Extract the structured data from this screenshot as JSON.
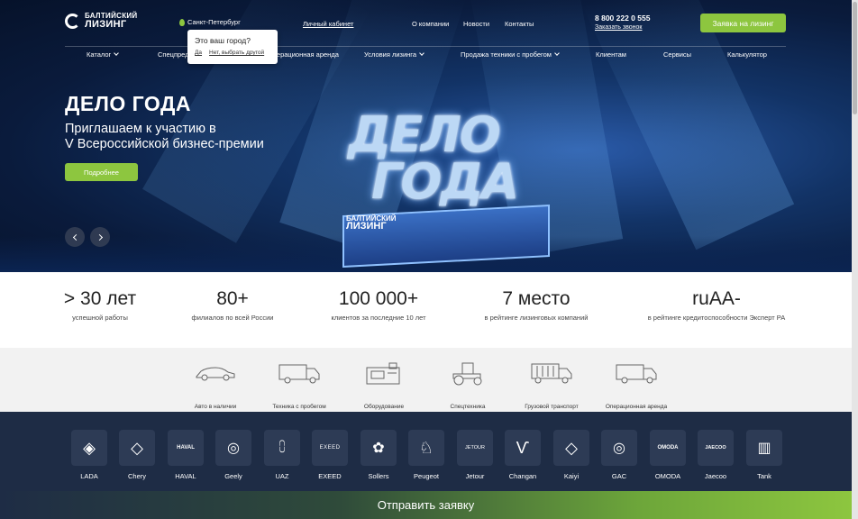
{
  "header": {
    "logo_line1": "БАЛТИЙСКИЙ",
    "logo_line2": "ЛИЗИНГ",
    "city": "Санкт-Петербург",
    "cabinet": "Личный кабинет",
    "top_links": [
      "О компании",
      "Новости",
      "Контакты"
    ],
    "phone": "8 800 222 0 555",
    "callback": "Заказать звонок",
    "apply": "Заявка на лизинг"
  },
  "city_popup": {
    "question": "Это ваш город?",
    "yes": "Да",
    "no": "Нет, выбрать другой"
  },
  "nav": [
    {
      "label": "Каталог",
      "dropdown": true
    },
    {
      "label": "Спецпред",
      "dropdown": false
    },
    {
      "label": "Операционная аренда",
      "dropdown": false
    },
    {
      "label": "Условия лизинга",
      "dropdown": true
    },
    {
      "label": "Продажа техники с пробегом",
      "dropdown": true
    },
    {
      "label": "Клиентам",
      "dropdown": false
    },
    {
      "label": "Сервисы",
      "dropdown": false
    },
    {
      "label": "Калькулятор",
      "dropdown": false
    }
  ],
  "hero": {
    "title": "ДЕЛО ГОДА",
    "subtitle_line1": "Приглашаем к участию в",
    "subtitle_line2": "V Всероссийской бизнес-премии",
    "button": "Подробнее",
    "trophy_line1": "ДЕЛО",
    "trophy_line2": "ГОДА",
    "trophy_logo1": "БАЛТИЙСКИЙ",
    "trophy_logo2": "ЛИЗИНГ"
  },
  "stats": [
    {
      "value": "> 30 лет",
      "label": "успешной работы"
    },
    {
      "value": "80+",
      "label": "филиалов по всей России"
    },
    {
      "value": "100 000+",
      "label": "клиентов за последние 10 лет"
    },
    {
      "value": "7 место",
      "label": "в рейтинге лизинговых компаний"
    },
    {
      "value": "ruAA-",
      "label": "в рейтинге кредитоспособности Эксперт РА"
    }
  ],
  "categories": [
    {
      "label": "Авто в наличии",
      "icon": "car-icon"
    },
    {
      "label": "Техника с пробегом",
      "icon": "van-icon"
    },
    {
      "label": "Оборудование",
      "icon": "equipment-icon"
    },
    {
      "label": "Спецтехника",
      "icon": "tractor-icon"
    },
    {
      "label": "Грузовой транспорт",
      "icon": "truck-icon"
    },
    {
      "label": "Операционная аренда",
      "icon": "van-icon"
    }
  ],
  "brands": [
    "LADA",
    "Chery",
    "HAVAL",
    "Geely",
    "UAZ",
    "EXEED",
    "Sollers",
    "Peugeot",
    "Jetour",
    "Changan",
    "Kaiyi",
    "GAC",
    "OMODA",
    "Jaecoo",
    "Tank"
  ],
  "brand_logos": [
    "◈",
    "◇",
    "HAVAL",
    "◎",
    "⩇",
    "EXEED",
    "✿",
    "♘",
    "JETOUR",
    "Ѵ",
    "◇",
    "◎",
    "OMODA",
    "JAECOO",
    "▥"
  ],
  "footer": {
    "cta": "Отправить заявку"
  },
  "colors": {
    "accent": "#8dc63f",
    "navy": "#1e2c45",
    "hero": "#0a1b3c"
  }
}
